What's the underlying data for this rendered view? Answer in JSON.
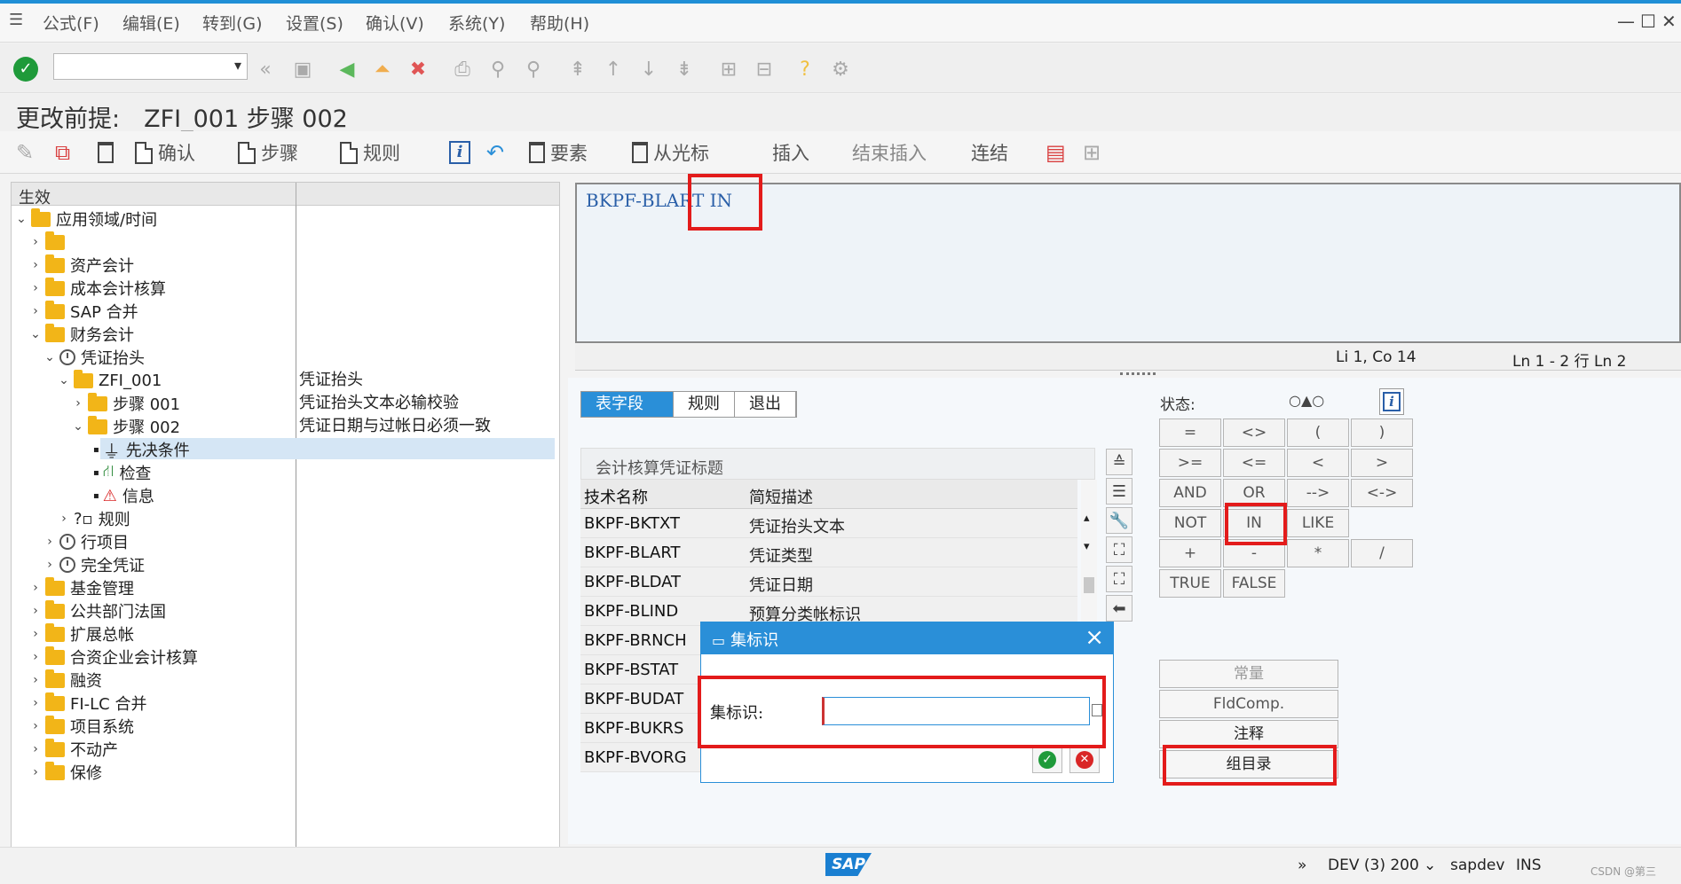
{
  "menu": [
    "公式(F)",
    "编辑(E)",
    "转到(G)",
    "设置(S)",
    "确认(V)",
    "系统(Y)",
    "帮助(H)"
  ],
  "title": "更改前提:　ZFI_001 步骤 002",
  "app_toolbar": {
    "confirm": "确认",
    "step": "步骤",
    "rule": "规则",
    "element": "要素",
    "from_cursor": "从光标",
    "insert": "插入",
    "end_insert": "结束插入",
    "link": "连结"
  },
  "tree": {
    "header": "生效",
    "rows": [
      {
        "label": "应用领域/时间"
      },
      {
        "label": ""
      },
      {
        "label": "资产会计"
      },
      {
        "label": "成本会计核算"
      },
      {
        "label": "SAP 合并"
      },
      {
        "label": "财务会计"
      },
      {
        "label": "凭证抬头"
      },
      {
        "label": "ZFI_001",
        "desc": "凭证抬头"
      },
      {
        "label": "步骤 001",
        "desc": "凭证抬头文本必输校验"
      },
      {
        "label": "步骤 002",
        "desc": "凭证日期与过帐日必须一致"
      },
      {
        "label": "先决条件"
      },
      {
        "label": "检查"
      },
      {
        "label": "信息"
      },
      {
        "label": "规则"
      },
      {
        "label": "行项目"
      },
      {
        "label": "完全凭证"
      },
      {
        "label": "基金管理"
      },
      {
        "label": "公共部门法国"
      },
      {
        "label": "扩展总帐"
      },
      {
        "label": "合资企业会计核算"
      },
      {
        "label": "融资"
      },
      {
        "label": "FI-LC 合并"
      },
      {
        "label": "项目系统"
      },
      {
        "label": "不动产"
      },
      {
        "label": "保修"
      }
    ]
  },
  "editor": {
    "text": "BKPF-BLART  IN",
    "position": "Li 1, Co 14",
    "lines": "Ln 1 - 2 行 Ln 2"
  },
  "tabs": [
    "表字段",
    "规则",
    "退出"
  ],
  "table": {
    "label": "会计核算凭证标题",
    "headers": [
      "技术名称",
      "简短描述"
    ],
    "rows": [
      [
        "BKPF-BKTXT",
        "凭证抬头文本"
      ],
      [
        "BKPF-BLART",
        "凭证类型"
      ],
      [
        "BKPF-BLDAT",
        "凭证日期"
      ],
      [
        "BKPF-BLIND",
        "预算分类帐标识"
      ],
      [
        "BKPF-BRNCH",
        ""
      ],
      [
        "BKPF-BSTAT",
        ""
      ],
      [
        "BKPF-BUDAT",
        ""
      ],
      [
        "BKPF-BUKRS",
        ""
      ],
      [
        "BKPF-BVORG",
        ""
      ]
    ]
  },
  "status": {
    "label": "状态:",
    "icons": "○▲○"
  },
  "operators": [
    [
      "=",
      "<>",
      "(",
      ")"
    ],
    [
      ">=",
      "<=",
      "<",
      ">"
    ],
    [
      "AND",
      "OR",
      "-->",
      "<->"
    ],
    [
      "NOT",
      "IN",
      "LIKE"
    ],
    [
      "+",
      "-",
      "*",
      "/"
    ],
    [
      "TRUE",
      "FALSE"
    ]
  ],
  "big_buttons": [
    "常量",
    "FldComp.",
    "注释",
    "组目录"
  ],
  "dialog": {
    "title": "集标识",
    "field_label": "集标识:",
    "value": ""
  },
  "statusbar": {
    "sap": "SAP",
    "system": "DEV (3) 200",
    "user": "sapdev",
    "mode": "INS",
    "watermark": "CSDN @第三"
  },
  "colors": {
    "accent": "#2a8fd8",
    "highlight": "#e31b1b",
    "editor_text": "#2a5fa8"
  }
}
